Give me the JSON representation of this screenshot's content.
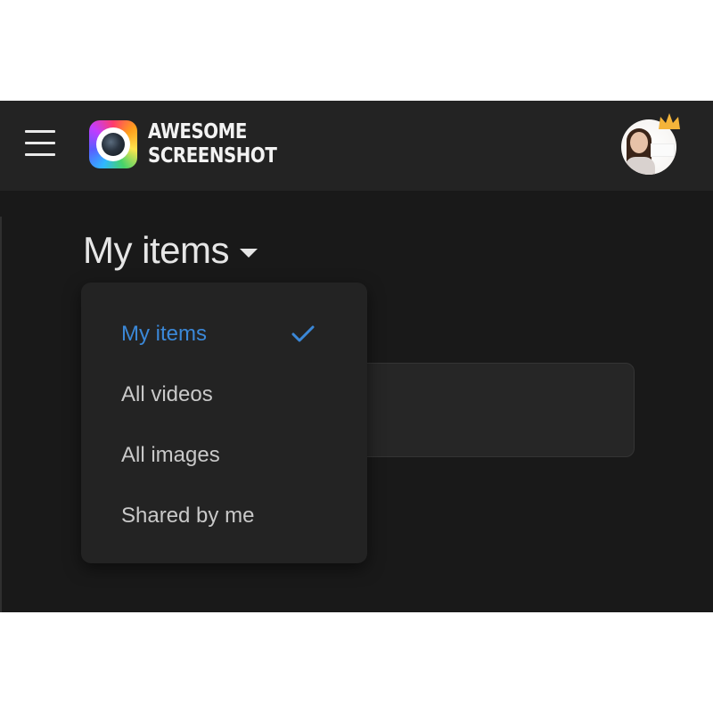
{
  "header": {
    "logo_line1": "AWESOME",
    "logo_line2": "SCREENSHOT"
  },
  "page": {
    "title": "My items"
  },
  "dropdown": {
    "items": [
      {
        "label": "My items",
        "selected": true
      },
      {
        "label": "All videos",
        "selected": false
      },
      {
        "label": "All images",
        "selected": false
      },
      {
        "label": "Shared by me",
        "selected": false
      }
    ]
  },
  "icons": {
    "menu": "hamburger-menu-icon",
    "logo": "camera-lens-icon",
    "avatar_badge": "crown-icon",
    "selected": "checkmark-icon",
    "title_toggle": "caret-down-icon"
  },
  "colors": {
    "background": "#191919",
    "header": "#232323",
    "dropdown": "#232323",
    "accent": "#3b88d8",
    "crown": "#f4b43a"
  }
}
